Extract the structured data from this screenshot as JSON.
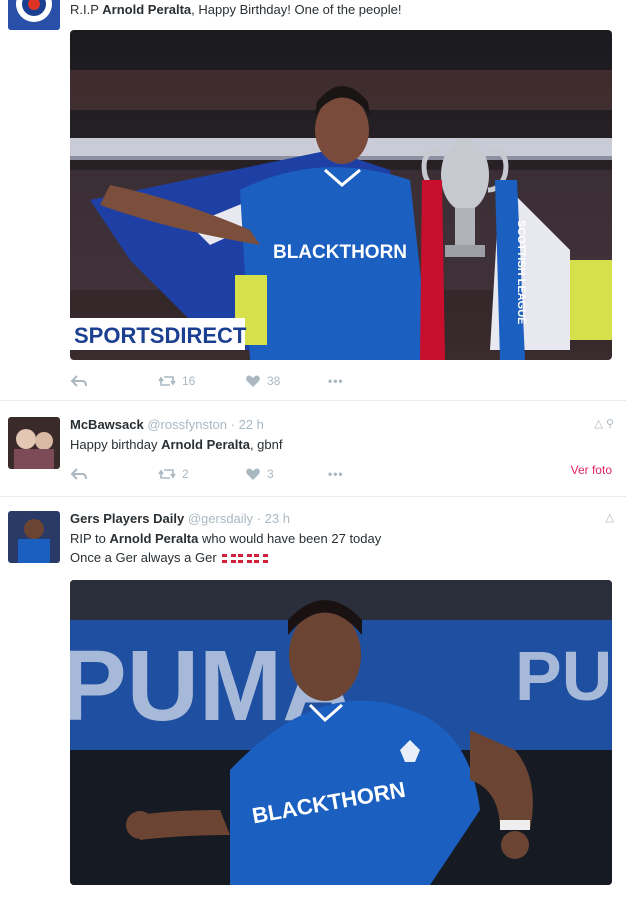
{
  "tweets": [
    {
      "id": "t1",
      "text_prefix": "R.I.P",
      "mention": "Arnold Peralta",
      "text_suffix": ", Happy Birthday! One of the people!",
      "retweets": "16",
      "likes": "38",
      "media_sign": "SPORTSDIRECT",
      "media_sponsor": "BLACKTHORN",
      "media_sash": "SCOTTISH LEAGUE"
    },
    {
      "id": "t2",
      "name": "McBawsack",
      "handle": "@rossfynston",
      "time": "· 22 h",
      "text_prefix": "Happy birthday",
      "mention": "Arnold Peralta",
      "text_suffix": ", gbnf",
      "retweets": "2",
      "likes": "3",
      "ver_foto": "Ver foto"
    },
    {
      "id": "t3",
      "name": "Gers Players Daily",
      "handle": "@gersdaily",
      "time": "· 23 h",
      "line1_prefix": "RIP to",
      "mention": "Arnold Peralta",
      "line1_suffix": "who would have been 27 today",
      "line2": "Once a Ger always a Ger",
      "media_banner": "PUMA",
      "media_banner_right": "PU",
      "media_sponsor": "BLACKTHORN"
    }
  ],
  "colors": {
    "text": "#292f33",
    "muted": "#aab8c2",
    "like": "#e0245e",
    "rangers_blue": "#1b5fc0"
  }
}
